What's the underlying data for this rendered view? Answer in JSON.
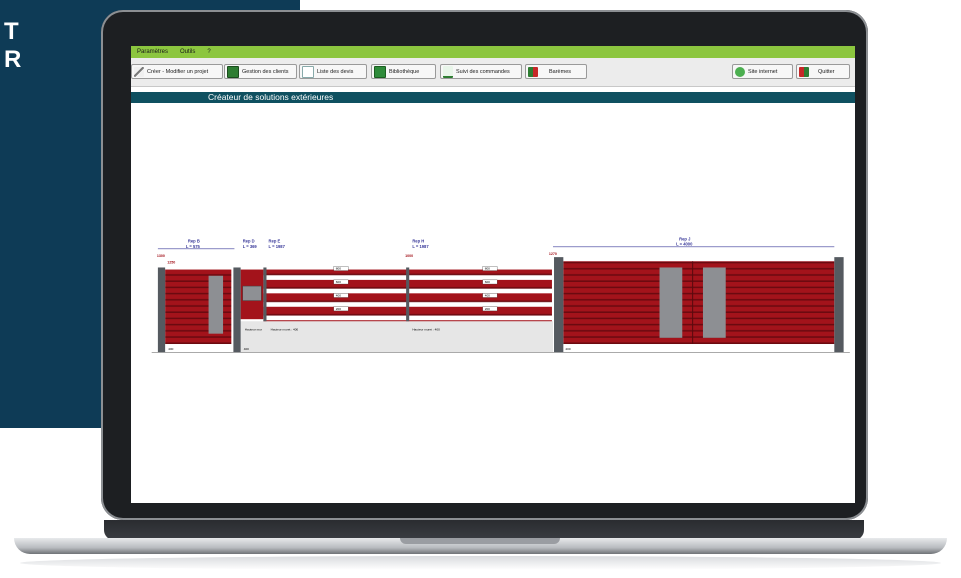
{
  "background_text": "T\nR",
  "menu": {
    "items": [
      "Paramètres",
      "Outils",
      "?"
    ]
  },
  "toolbar": {
    "create": "Créer - Modifier un projet",
    "clients": "Gestion des clients",
    "quotes": "Liste des devis",
    "library": "Bibliothèque",
    "orders": "Suivi des commandes",
    "scales": "Barèmes",
    "website": "Site internet",
    "quit": "Quitter"
  },
  "banner_title": "Créateur de solutions extérieures",
  "drawing": {
    "rep_b": "Rep B",
    "rep_b_len": "L = 575",
    "rep_d": "Rep D",
    "rep_d_len": "L = 369",
    "rep_e": "Rep E",
    "rep_e_len": "L = 1987",
    "rep_h": "Rep H",
    "rep_h_len": "L = 1987",
    "rep_j": "Rep J",
    "rep_j_len": "L = 4000",
    "h_1300": "1300",
    "h_1250": "1250",
    "h_1000": "1000",
    "h_1270": "1270",
    "wall_label_1": "Hauteur mur",
    "wall_label_2": "Hauteur muret : 400",
    "wall_label_3": "Hauteur muret : 400",
    "base_400": "400",
    "rail_values": [
      "800",
      "800",
      "600",
      "600",
      "400",
      "400",
      "200",
      "200"
    ]
  },
  "colors": {
    "menubar": "#8cc63f",
    "banner": "#0f5060",
    "gate_red": "#a3131b",
    "post": "#555a60",
    "navy": "#0e3b56"
  }
}
